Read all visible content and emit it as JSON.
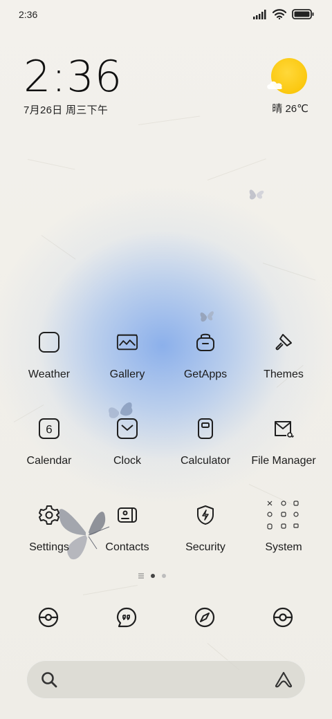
{
  "status_bar": {
    "time": "2:36",
    "icons": [
      "signal-icon",
      "wifi-icon",
      "battery-icon"
    ]
  },
  "clock_widget": {
    "time": "2:36",
    "date": "7月26日 周三下午"
  },
  "weather_widget": {
    "condition_icon": "partly-sunny-icon",
    "text": "晴 26℃"
  },
  "apps": [
    {
      "label": "Weather",
      "icon": "weather-icon"
    },
    {
      "label": "Gallery",
      "icon": "gallery-icon"
    },
    {
      "label": "GetApps",
      "icon": "getapps-icon"
    },
    {
      "label": "Themes",
      "icon": "themes-brush-icon"
    },
    {
      "label": "Calendar",
      "icon": "calendar-icon",
      "icon_text": "6"
    },
    {
      "label": "Clock",
      "icon": "clock-icon"
    },
    {
      "label": "Calculator",
      "icon": "calculator-icon"
    },
    {
      "label": "File Manager",
      "icon": "file-manager-icon"
    },
    {
      "label": "Settings",
      "icon": "gear-icon"
    },
    {
      "label": "Contacts",
      "icon": "contacts-icon"
    },
    {
      "label": "Security",
      "icon": "security-shield-icon"
    },
    {
      "label": "System",
      "icon": "folder-grid-icon"
    }
  ],
  "page_indicator": {
    "pages": 2,
    "active": 1
  },
  "dock": [
    {
      "icon": "phone-dialer-icon"
    },
    {
      "icon": "messages-icon"
    },
    {
      "icon": "browser-compass-icon"
    },
    {
      "icon": "camera-icon"
    }
  ],
  "search_bar": {
    "left_icon": "search-icon",
    "right_icon": "assistant-icon"
  },
  "colors": {
    "background": "#f1efe9",
    "wallpaper_glow": "#7aa5eb",
    "sun": "#fbc80f",
    "icon_stroke": "#1f1f1f"
  }
}
